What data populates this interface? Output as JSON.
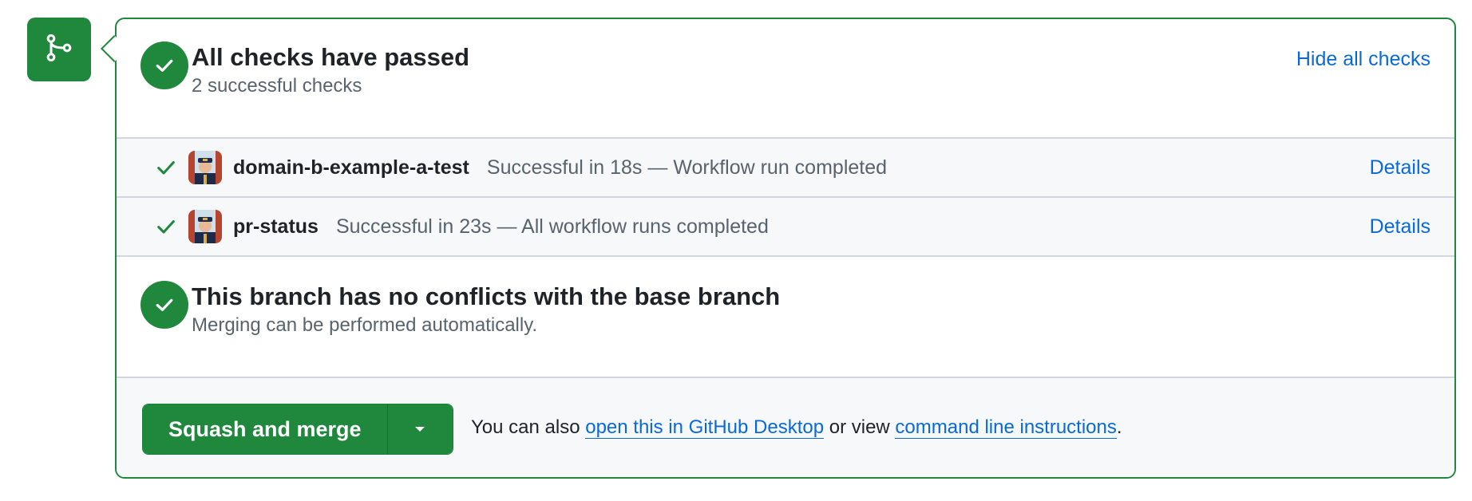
{
  "checks": {
    "title": "All checks have passed",
    "subtitle": "2 successful checks",
    "toggle_label": "Hide all checks",
    "items": [
      {
        "name": "domain-b-example-a-test",
        "description": "Successful in 18s — Workflow run completed",
        "action_label": "Details"
      },
      {
        "name": "pr-status",
        "description": "Successful in 23s — All workflow runs completed",
        "action_label": "Details"
      }
    ]
  },
  "conflicts": {
    "title": "This branch has no conflicts with the base branch",
    "subtitle": "Merging can be performed automatically."
  },
  "merge": {
    "button_label": "Squash and merge",
    "help_prefix": "You can also ",
    "desktop_link": "open this in GitHub Desktop",
    "help_middle": " or view ",
    "cli_link": "command line instructions",
    "help_suffix": "."
  },
  "icons": {
    "badge": "git-merge-icon",
    "status": "check-icon",
    "dropdown": "triangle-down-icon"
  },
  "colors": {
    "success": "#1f883d",
    "link": "#0969da",
    "muted_text": "#59636e",
    "row_background": "#f6f8fa",
    "border": "#d0d7de"
  }
}
